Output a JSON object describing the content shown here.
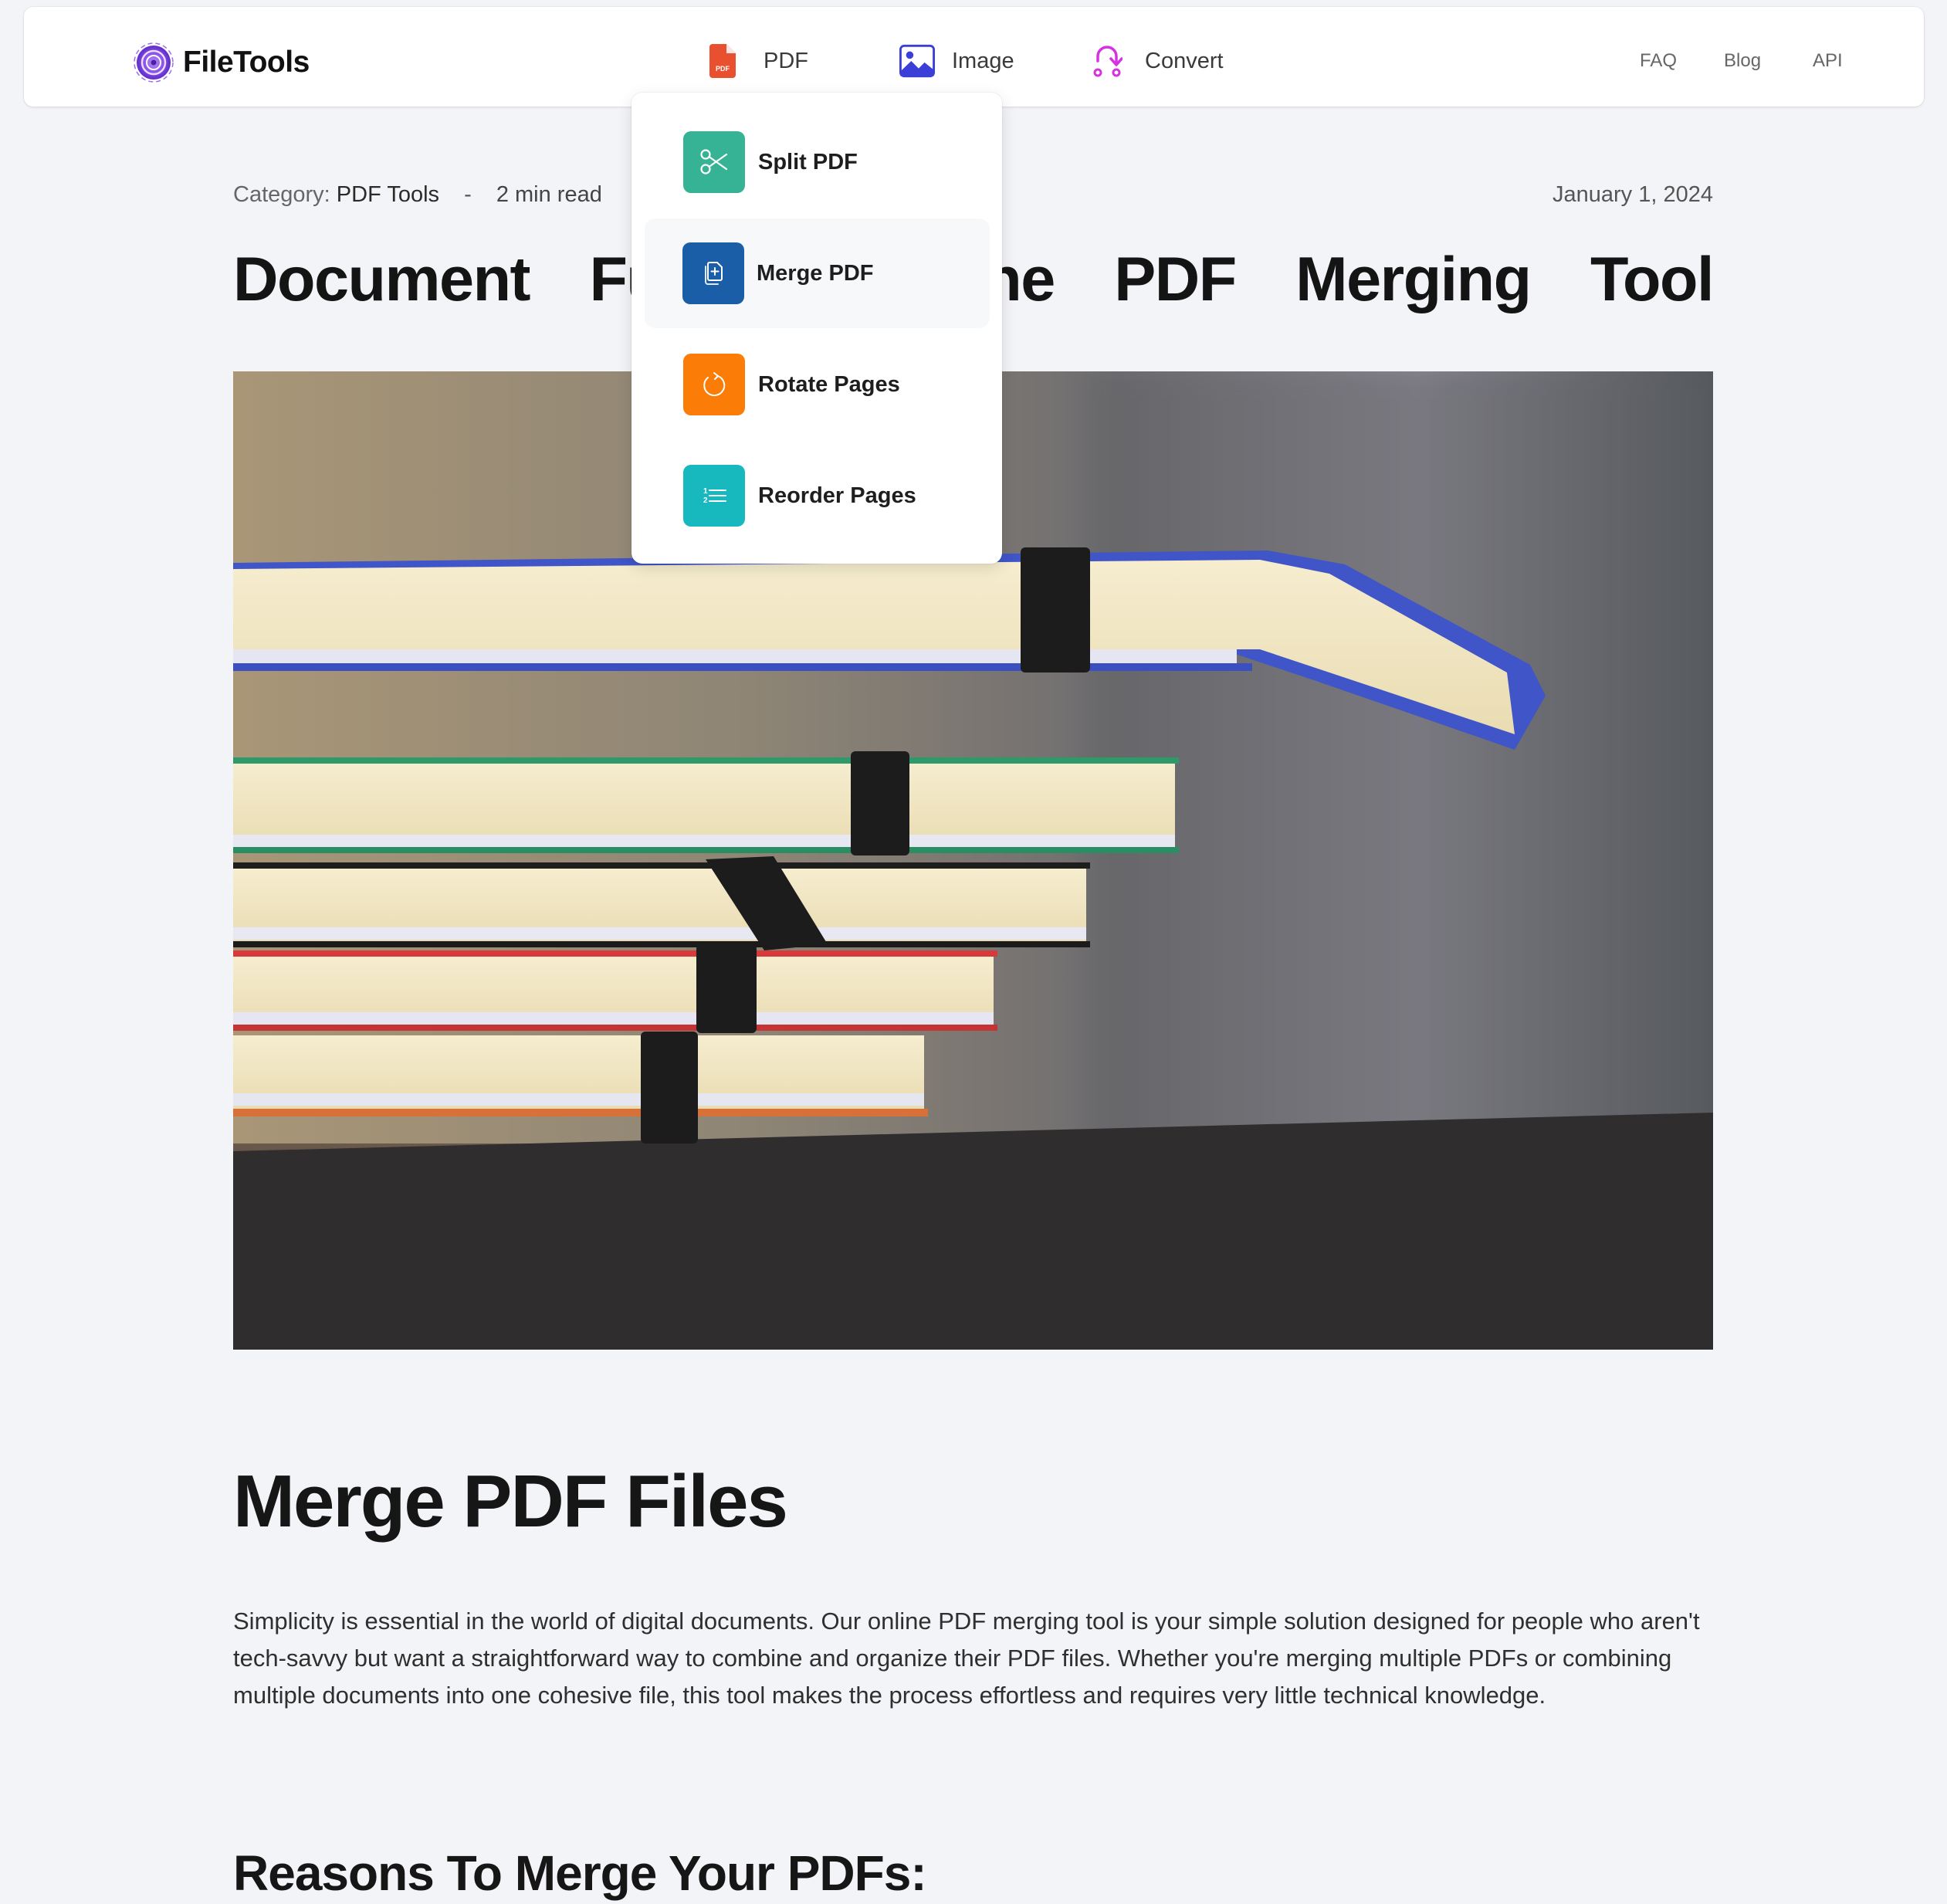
{
  "header": {
    "logo_text": "FileTools",
    "logo_icon": "spiral-logo-icon",
    "nav_items": [
      {
        "label": "PDF",
        "icon": "pdf-file-icon",
        "color": "#e8502f"
      },
      {
        "label": "Image",
        "icon": "image-icon",
        "color": "#3b3fd8"
      },
      {
        "label": "Convert",
        "icon": "convert-arrow-icon",
        "color": "#d633e0"
      }
    ],
    "right_links": [
      "FAQ",
      "Blog",
      "API"
    ]
  },
  "dropdown": {
    "items": [
      {
        "label": "Split PDF",
        "icon": "scissors-icon",
        "color": "#36b394"
      },
      {
        "label": "Merge PDF",
        "icon": "merge-pages-icon",
        "color": "#1a5ea8",
        "hovered": true
      },
      {
        "label": "Rotate Pages",
        "icon": "rotate-icon",
        "color": "#fb7d07"
      },
      {
        "label": "Reorder Pages",
        "icon": "numbered-list-icon",
        "color": "#17b8be"
      }
    ]
  },
  "article": {
    "category_label": "Category:",
    "category_value": "PDF Tools",
    "separator": "-",
    "read_time": "2 min read",
    "date": "January 1, 2024",
    "title": "Document Fusion: Online PDF Merging Tool",
    "hero_image_alt": "Stack of notebooks with elastic bands",
    "section_title": "Merge PDF Files",
    "paragraph": "Simplicity is essential in the world of digital documents. Our online PDF merging tool is your simple solution designed for people who aren't tech-savvy but want a straightforward way to combine and organize their PDF files. Whether you're merging multiple PDFs or combining multiple documents into one cohesive file, this tool makes the process effortless and requires very little technical knowledge.",
    "section_title_2": "Reasons To Merge Your PDFs:"
  },
  "colors": {
    "background": "#f3f4f7",
    "nav_background": "#ffffff",
    "brand_purple": "#7b3fe4"
  }
}
